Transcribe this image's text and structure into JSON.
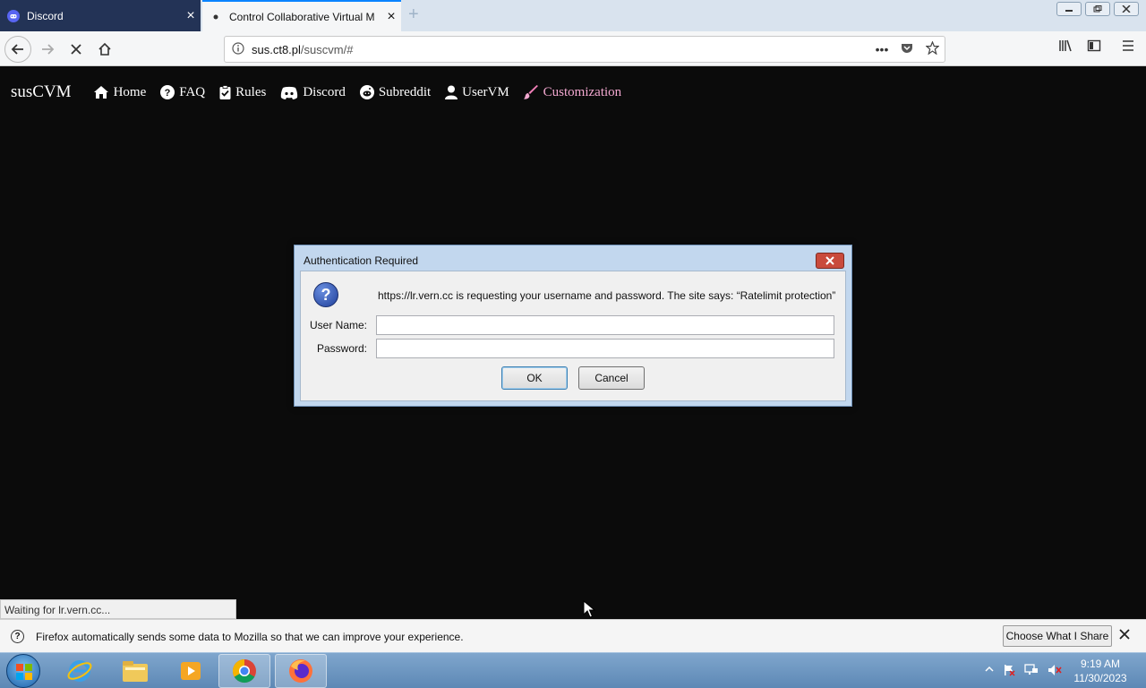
{
  "browser": {
    "tabs": [
      {
        "label": "Discord",
        "close": "×"
      },
      {
        "label": "Control Collaborative Virtual M",
        "close": "×"
      }
    ],
    "new_tab": "+",
    "url_domain": "sus.ct8.pl",
    "url_path": "/suscvm/#",
    "page_actions": "•••",
    "status_text": "Waiting for lr.vern.cc..."
  },
  "site": {
    "brand": "susCVM",
    "nav": [
      {
        "label": "Home"
      },
      {
        "label": "FAQ"
      },
      {
        "label": "Rules"
      },
      {
        "label": "Discord"
      },
      {
        "label": "Subreddit"
      },
      {
        "label": "UserVM"
      },
      {
        "label": "Customization"
      }
    ]
  },
  "dialog": {
    "title": "Authentication Required",
    "message": "https://lr.vern.cc is requesting your username and password. The site says: “Ratelimit protection”",
    "username_label": "User Name:",
    "username_value": "",
    "password_label": "Password:",
    "password_value": "",
    "ok_label": "OK",
    "cancel_label": "Cancel"
  },
  "notification": {
    "text": "Firefox automatically sends some data to Mozilla so that we can improve your experience.",
    "button_label": "Choose What I Share"
  },
  "taskbar": {
    "time": "9:19 AM",
    "date": "11/30/2023"
  },
  "colors": {
    "page_bg": "#0b0b0b",
    "customization_accent": "#f3a8d0",
    "discord_tab_bg": "#233356",
    "dialog_frame": "#c2d7ee"
  }
}
